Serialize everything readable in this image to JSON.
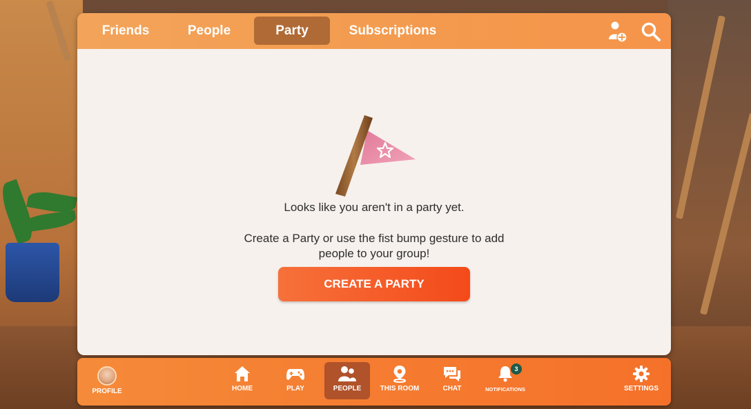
{
  "tabs": [
    {
      "label": "Friends"
    },
    {
      "label": "People"
    },
    {
      "label": "Party",
      "active": true
    },
    {
      "label": "Subscriptions"
    }
  ],
  "header_icons": [
    "add-person-icon",
    "search-icon"
  ],
  "party": {
    "empty_message": "Looks like you aren't in a party yet.",
    "help_text": "Create a Party or use the fist bump gesture to add people to your group!",
    "create_button": "CREATE A PARTY"
  },
  "nav": {
    "profile": "PROFILE",
    "home": "HOME",
    "play": "PLAY",
    "people": "PEOPLE",
    "this_room": "THIS ROOM",
    "chat": "CHAT",
    "notifications": "NOTIFICATIONS",
    "notifications_count": "3",
    "settings": "SETTINGS",
    "active": "people"
  },
  "colors": {
    "accent": "#f57c30",
    "tab_active": "#b06a35",
    "button": "#f4531f",
    "panel_bg": "#f6f1ed",
    "badge": "#1d5a4a"
  }
}
